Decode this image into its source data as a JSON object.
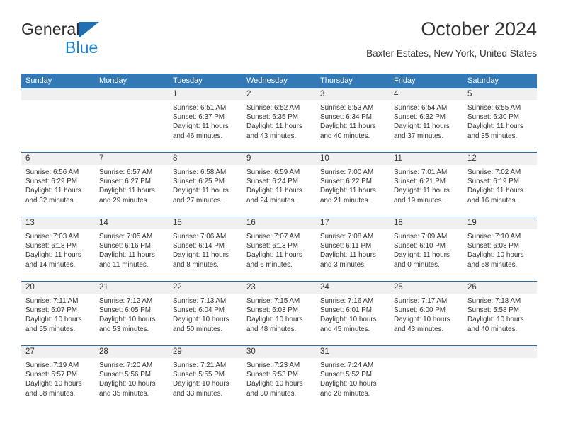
{
  "brand": {
    "name_part1": "General",
    "name_part2": "Blue",
    "triangle_color": "#1f6fb2",
    "blue_text_color": "#1b82d2"
  },
  "header": {
    "title": "October 2024",
    "subtitle": "Baxter Estates, New York, United States"
  },
  "theme": {
    "header_blue": "#3379b5",
    "separator_blue": "#2a6ca8",
    "daynum_band": "#f0f0f0"
  },
  "calendar": {
    "weekdays": [
      "Sunday",
      "Monday",
      "Tuesday",
      "Wednesday",
      "Thursday",
      "Friday",
      "Saturday"
    ],
    "weeks": [
      [
        {
          "day": "",
          "sunrise": "",
          "sunset": "",
          "daylight_line1": "",
          "daylight_line2": ""
        },
        {
          "day": "",
          "sunrise": "",
          "sunset": "",
          "daylight_line1": "",
          "daylight_line2": ""
        },
        {
          "day": "1",
          "sunrise": "Sunrise: 6:51 AM",
          "sunset": "Sunset: 6:37 PM",
          "daylight_line1": "Daylight: 11 hours",
          "daylight_line2": "and 46 minutes."
        },
        {
          "day": "2",
          "sunrise": "Sunrise: 6:52 AM",
          "sunset": "Sunset: 6:35 PM",
          "daylight_line1": "Daylight: 11 hours",
          "daylight_line2": "and 43 minutes."
        },
        {
          "day": "3",
          "sunrise": "Sunrise: 6:53 AM",
          "sunset": "Sunset: 6:34 PM",
          "daylight_line1": "Daylight: 11 hours",
          "daylight_line2": "and 40 minutes."
        },
        {
          "day": "4",
          "sunrise": "Sunrise: 6:54 AM",
          "sunset": "Sunset: 6:32 PM",
          "daylight_line1": "Daylight: 11 hours",
          "daylight_line2": "and 37 minutes."
        },
        {
          "day": "5",
          "sunrise": "Sunrise: 6:55 AM",
          "sunset": "Sunset: 6:30 PM",
          "daylight_line1": "Daylight: 11 hours",
          "daylight_line2": "and 35 minutes."
        }
      ],
      [
        {
          "day": "6",
          "sunrise": "Sunrise: 6:56 AM",
          "sunset": "Sunset: 6:29 PM",
          "daylight_line1": "Daylight: 11 hours",
          "daylight_line2": "and 32 minutes."
        },
        {
          "day": "7",
          "sunrise": "Sunrise: 6:57 AM",
          "sunset": "Sunset: 6:27 PM",
          "daylight_line1": "Daylight: 11 hours",
          "daylight_line2": "and 29 minutes."
        },
        {
          "day": "8",
          "sunrise": "Sunrise: 6:58 AM",
          "sunset": "Sunset: 6:25 PM",
          "daylight_line1": "Daylight: 11 hours",
          "daylight_line2": "and 27 minutes."
        },
        {
          "day": "9",
          "sunrise": "Sunrise: 6:59 AM",
          "sunset": "Sunset: 6:24 PM",
          "daylight_line1": "Daylight: 11 hours",
          "daylight_line2": "and 24 minutes."
        },
        {
          "day": "10",
          "sunrise": "Sunrise: 7:00 AM",
          "sunset": "Sunset: 6:22 PM",
          "daylight_line1": "Daylight: 11 hours",
          "daylight_line2": "and 21 minutes."
        },
        {
          "day": "11",
          "sunrise": "Sunrise: 7:01 AM",
          "sunset": "Sunset: 6:21 PM",
          "daylight_line1": "Daylight: 11 hours",
          "daylight_line2": "and 19 minutes."
        },
        {
          "day": "12",
          "sunrise": "Sunrise: 7:02 AM",
          "sunset": "Sunset: 6:19 PM",
          "daylight_line1": "Daylight: 11 hours",
          "daylight_line2": "and 16 minutes."
        }
      ],
      [
        {
          "day": "13",
          "sunrise": "Sunrise: 7:03 AM",
          "sunset": "Sunset: 6:18 PM",
          "daylight_line1": "Daylight: 11 hours",
          "daylight_line2": "and 14 minutes."
        },
        {
          "day": "14",
          "sunrise": "Sunrise: 7:05 AM",
          "sunset": "Sunset: 6:16 PM",
          "daylight_line1": "Daylight: 11 hours",
          "daylight_line2": "and 11 minutes."
        },
        {
          "day": "15",
          "sunrise": "Sunrise: 7:06 AM",
          "sunset": "Sunset: 6:14 PM",
          "daylight_line1": "Daylight: 11 hours",
          "daylight_line2": "and 8 minutes."
        },
        {
          "day": "16",
          "sunrise": "Sunrise: 7:07 AM",
          "sunset": "Sunset: 6:13 PM",
          "daylight_line1": "Daylight: 11 hours",
          "daylight_line2": "and 6 minutes."
        },
        {
          "day": "17",
          "sunrise": "Sunrise: 7:08 AM",
          "sunset": "Sunset: 6:11 PM",
          "daylight_line1": "Daylight: 11 hours",
          "daylight_line2": "and 3 minutes."
        },
        {
          "day": "18",
          "sunrise": "Sunrise: 7:09 AM",
          "sunset": "Sunset: 6:10 PM",
          "daylight_line1": "Daylight: 11 hours",
          "daylight_line2": "and 0 minutes."
        },
        {
          "day": "19",
          "sunrise": "Sunrise: 7:10 AM",
          "sunset": "Sunset: 6:08 PM",
          "daylight_line1": "Daylight: 10 hours",
          "daylight_line2": "and 58 minutes."
        }
      ],
      [
        {
          "day": "20",
          "sunrise": "Sunrise: 7:11 AM",
          "sunset": "Sunset: 6:07 PM",
          "daylight_line1": "Daylight: 10 hours",
          "daylight_line2": "and 55 minutes."
        },
        {
          "day": "21",
          "sunrise": "Sunrise: 7:12 AM",
          "sunset": "Sunset: 6:05 PM",
          "daylight_line1": "Daylight: 10 hours",
          "daylight_line2": "and 53 minutes."
        },
        {
          "day": "22",
          "sunrise": "Sunrise: 7:13 AM",
          "sunset": "Sunset: 6:04 PM",
          "daylight_line1": "Daylight: 10 hours",
          "daylight_line2": "and 50 minutes."
        },
        {
          "day": "23",
          "sunrise": "Sunrise: 7:15 AM",
          "sunset": "Sunset: 6:03 PM",
          "daylight_line1": "Daylight: 10 hours",
          "daylight_line2": "and 48 minutes."
        },
        {
          "day": "24",
          "sunrise": "Sunrise: 7:16 AM",
          "sunset": "Sunset: 6:01 PM",
          "daylight_line1": "Daylight: 10 hours",
          "daylight_line2": "and 45 minutes."
        },
        {
          "day": "25",
          "sunrise": "Sunrise: 7:17 AM",
          "sunset": "Sunset: 6:00 PM",
          "daylight_line1": "Daylight: 10 hours",
          "daylight_line2": "and 43 minutes."
        },
        {
          "day": "26",
          "sunrise": "Sunrise: 7:18 AM",
          "sunset": "Sunset: 5:58 PM",
          "daylight_line1": "Daylight: 10 hours",
          "daylight_line2": "and 40 minutes."
        }
      ],
      [
        {
          "day": "27",
          "sunrise": "Sunrise: 7:19 AM",
          "sunset": "Sunset: 5:57 PM",
          "daylight_line1": "Daylight: 10 hours",
          "daylight_line2": "and 38 minutes."
        },
        {
          "day": "28",
          "sunrise": "Sunrise: 7:20 AM",
          "sunset": "Sunset: 5:56 PM",
          "daylight_line1": "Daylight: 10 hours",
          "daylight_line2": "and 35 minutes."
        },
        {
          "day": "29",
          "sunrise": "Sunrise: 7:21 AM",
          "sunset": "Sunset: 5:55 PM",
          "daylight_line1": "Daylight: 10 hours",
          "daylight_line2": "and 33 minutes."
        },
        {
          "day": "30",
          "sunrise": "Sunrise: 7:23 AM",
          "sunset": "Sunset: 5:53 PM",
          "daylight_line1": "Daylight: 10 hours",
          "daylight_line2": "and 30 minutes."
        },
        {
          "day": "31",
          "sunrise": "Sunrise: 7:24 AM",
          "sunset": "Sunset: 5:52 PM",
          "daylight_line1": "Daylight: 10 hours",
          "daylight_line2": "and 28 minutes."
        },
        {
          "day": "",
          "sunrise": "",
          "sunset": "",
          "daylight_line1": "",
          "daylight_line2": ""
        },
        {
          "day": "",
          "sunrise": "",
          "sunset": "",
          "daylight_line1": "",
          "daylight_line2": ""
        }
      ]
    ]
  }
}
